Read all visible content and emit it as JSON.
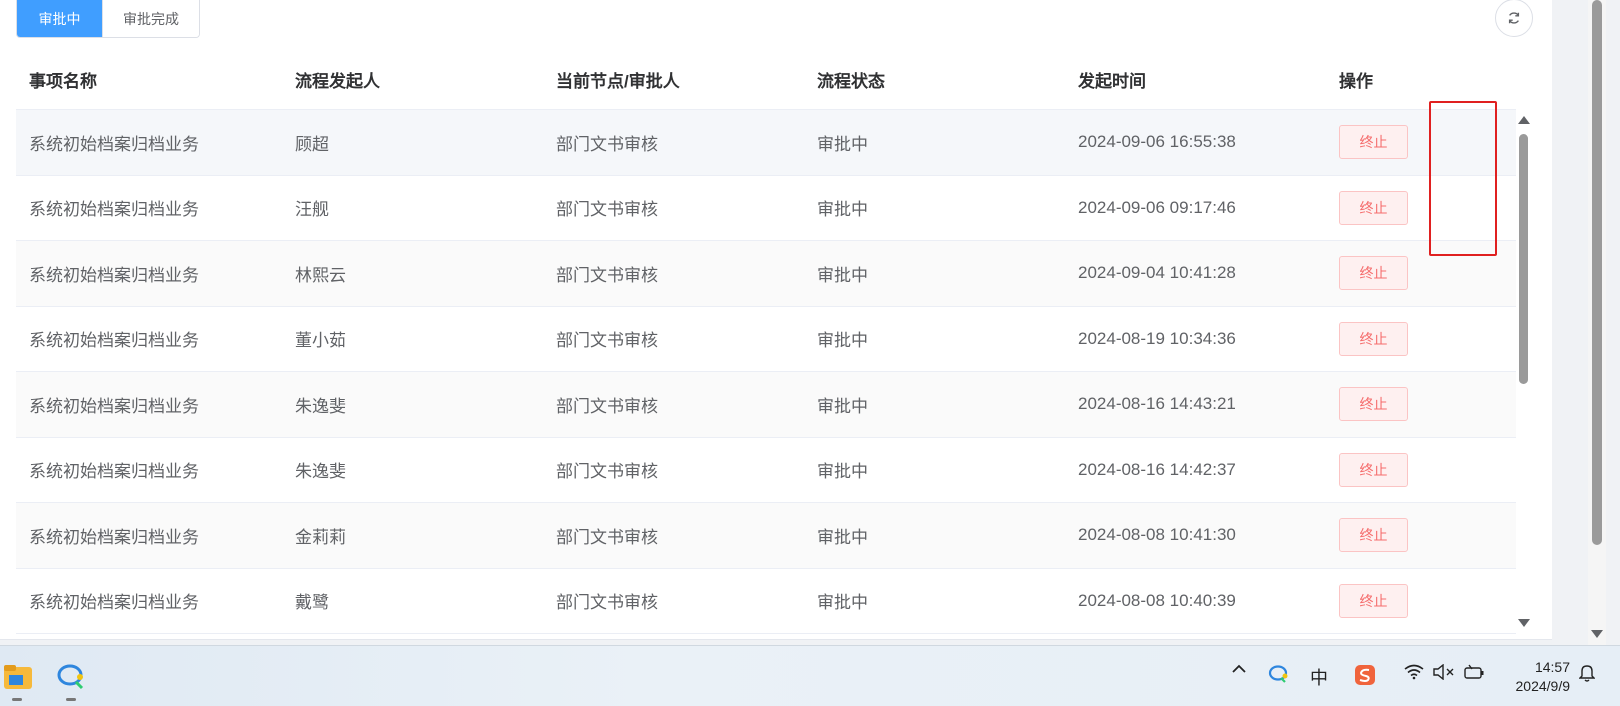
{
  "tabs": {
    "pending": "审批中",
    "done": "审批完成"
  },
  "table": {
    "headers": [
      "事项名称",
      "流程发起人",
      "当前节点/审批人",
      "流程状态",
      "发起时间",
      "操作"
    ],
    "rows": [
      {
        "name": "系统初始档案归档业务",
        "initiator": "顾超",
        "node": "部门文书审核",
        "status": "审批中",
        "time": "2024-09-06 16:55:38",
        "action": "终止"
      },
      {
        "name": "系统初始档案归档业务",
        "initiator": "汪舰",
        "node": "部门文书审核",
        "status": "审批中",
        "time": "2024-09-06 09:17:46",
        "action": "终止"
      },
      {
        "name": "系统初始档案归档业务",
        "initiator": "林熙云",
        "node": "部门文书审核",
        "status": "审批中",
        "time": "2024-09-04 10:41:28",
        "action": "终止"
      },
      {
        "name": "系统初始档案归档业务",
        "initiator": "董小茹",
        "node": "部门文书审核",
        "status": "审批中",
        "time": "2024-08-19 10:34:36",
        "action": "终止"
      },
      {
        "name": "系统初始档案归档业务",
        "initiator": "朱逸斐",
        "node": "部门文书审核",
        "status": "审批中",
        "time": "2024-08-16 14:43:21",
        "action": "终止"
      },
      {
        "name": "系统初始档案归档业务",
        "initiator": "朱逸斐",
        "node": "部门文书审核",
        "status": "审批中",
        "time": "2024-08-16 14:42:37",
        "action": "终止"
      },
      {
        "name": "系统初始档案归档业务",
        "initiator": "金莉莉",
        "node": "部门文书审核",
        "status": "审批中",
        "time": "2024-08-08 10:41:30",
        "action": "终止"
      },
      {
        "name": "系统初始档案归档业务",
        "initiator": "戴鹭",
        "node": "部门文书审核",
        "status": "审批中",
        "time": "2024-08-08 10:40:39",
        "action": "终止"
      }
    ]
  },
  "taskbar": {
    "ime": "中",
    "time": "14:57",
    "date": "2024/9/9"
  },
  "colors": {
    "primary": "#409eff",
    "danger": "#f56c6c",
    "highlight": "#e02020"
  }
}
